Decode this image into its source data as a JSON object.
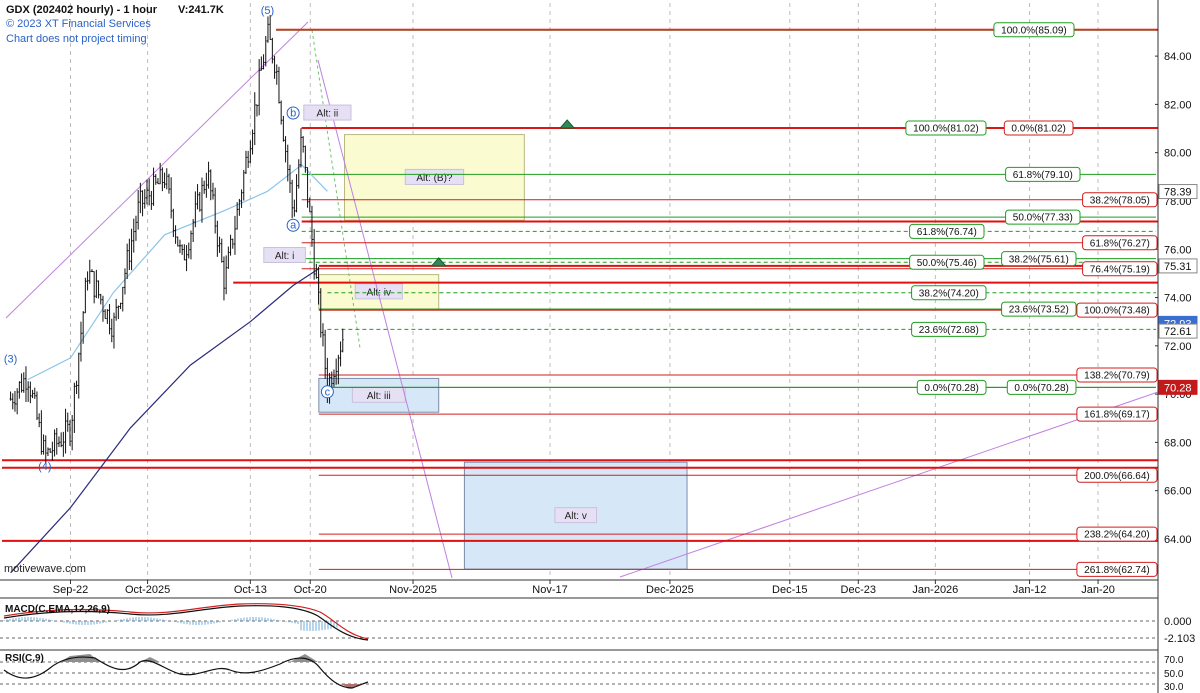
{
  "header": {
    "title": "GDX (202402 hourly) - 1 hour",
    "volume": "V:241.7K",
    "copyright": "© 2023 XT Financial Services",
    "disclaimer": "Chart does not project timing"
  },
  "watermark": "motivewave.com",
  "colors": {
    "fib_green": "#1e9e1e",
    "fib_red": "#d21e1e",
    "support_red": "#e01010",
    "olive": "#8a8a3a",
    "navy": "#2a2a7a",
    "ma_blue": "#8cc4ea",
    "purple": "#c080e0",
    "yellow_zone": "#fbfbd2",
    "blue_zone": "#d6e8f8",
    "wave_label": "#2a62c8"
  },
  "chart_data": {
    "type": "candlestick",
    "title": "GDX (202402 hourly) - 1 hour",
    "y_range": [
      62.3,
      86.2
    ],
    "y_ticks": [
      64.0,
      66.0,
      68.0,
      70.0,
      72.0,
      74.0,
      76.0,
      78.0,
      80.0,
      82.0,
      84.0
    ],
    "x_ticks": [
      {
        "label": "Sep-22",
        "date": "2025-09-22"
      },
      {
        "label": "Oct-2025",
        "date": "2025-10-01"
      },
      {
        "label": "Oct-13",
        "date": "2025-10-13"
      },
      {
        "label": "Oct-20",
        "date": "2025-10-20"
      },
      {
        "label": "Nov-2025",
        "date": "2025-11-01"
      },
      {
        "label": "Nov-17",
        "date": "2025-11-17"
      },
      {
        "label": "Dec-2025",
        "date": "2025-12-01"
      },
      {
        "label": "Dec-15",
        "date": "2025-12-15"
      },
      {
        "label": "Dec-23",
        "date": "2025-12-23"
      },
      {
        "label": "Jan-2026",
        "date": "2026-01-01"
      },
      {
        "label": "Jan-12",
        "date": "2026-01-12"
      },
      {
        "label": "Jan-20",
        "date": "2026-01-20"
      }
    ],
    "price_keypoints": [
      [
        "2025-09-15",
        69.8
      ],
      [
        "2025-09-17",
        70.8
      ],
      [
        "2025-09-19",
        67.4
      ],
      [
        "2025-09-22",
        68.6
      ],
      [
        "2025-09-24",
        75.1
      ],
      [
        "2025-09-27",
        72.8
      ],
      [
        "2025-09-30",
        77.8
      ],
      [
        "2025-10-03",
        79.0
      ],
      [
        "2025-10-05",
        75.5
      ],
      [
        "2025-10-08",
        79.2
      ],
      [
        "2025-10-10",
        74.6
      ],
      [
        "2025-10-12",
        78.6
      ],
      [
        "2025-10-15",
        84.9
      ],
      [
        "2025-10-16",
        83.6
      ],
      [
        "2025-10-18",
        77.4
      ],
      [
        "2025-10-19",
        80.6
      ],
      [
        "2025-10-21",
        73.6
      ],
      [
        "2025-10-22",
        70.3
      ],
      [
        "2025-10-24",
        72.6
      ]
    ],
    "moving_averages": [
      {
        "name": "short MA",
        "color": "#8cc4ea",
        "points": [
          [
            "2025-09-17",
            70.6
          ],
          [
            "2025-09-22",
            71.5
          ],
          [
            "2025-09-27",
            74.2
          ],
          [
            "2025-10-03",
            76.6
          ],
          [
            "2025-10-10",
            77.6
          ],
          [
            "2025-10-15",
            78.4
          ],
          [
            "2025-10-19",
            79.5
          ],
          [
            "2025-10-22",
            78.4
          ]
        ]
      },
      {
        "name": "long MA",
        "color": "#2a2a7a",
        "points": [
          [
            "2025-09-15",
            62.6
          ],
          [
            "2025-09-22",
            65.3
          ],
          [
            "2025-09-29",
            68.6
          ],
          [
            "2025-10-06",
            71.2
          ],
          [
            "2025-10-13",
            73.0
          ],
          [
            "2025-10-18",
            74.5
          ],
          [
            "2025-10-21",
            75.2
          ]
        ]
      }
    ],
    "horizontal_levels": [
      {
        "label": "100.0%(85.09)",
        "value": 85.09,
        "color": "green",
        "from": "2025-10-16"
      },
      {
        "label": "100.0%(81.02)",
        "value": 81.02,
        "color": "green",
        "from": "2025-10-19"
      },
      {
        "label": "0.0%(81.02)",
        "value": 81.02,
        "color": "red",
        "from": "2025-10-19"
      },
      {
        "label": "61.8%(79.10)",
        "value": 79.1,
        "color": "green",
        "from": "2025-10-19"
      },
      {
        "label": "38.2%(78.05)",
        "value": 78.05,
        "color": "red",
        "from": "2025-10-19"
      },
      {
        "label": "50.0%(77.33)",
        "value": 77.33,
        "color": "green",
        "from": "2025-10-19"
      },
      {
        "label": "61.8%(76.74)",
        "value": 76.74,
        "color": "green",
        "dashed": true,
        "from": "2025-10-19"
      },
      {
        "label": "61.8%(76.27)",
        "value": 76.27,
        "color": "red",
        "from": "2025-10-19"
      },
      {
        "label": "38.2%(75.61)",
        "value": 75.61,
        "color": "green",
        "from": "2025-10-19"
      },
      {
        "label": "50.0%(75.46)",
        "value": 75.46,
        "color": "green",
        "dashed": true,
        "from": "2025-10-19"
      },
      {
        "label": "76.4%(75.19)",
        "value": 75.19,
        "color": "red",
        "from": "2025-10-19"
      },
      {
        "label": "38.2%(74.20)",
        "value": 74.2,
        "color": "green",
        "dashed": true,
        "from": "2025-10-22"
      },
      {
        "label": "23.6%(73.52)",
        "value": 73.52,
        "color": "green",
        "from": "2025-10-21"
      },
      {
        "label": "100.0%(73.48)",
        "value": 73.48,
        "color": "red",
        "from": "2025-10-21"
      },
      {
        "label": "23.6%(72.68)",
        "value": 72.68,
        "color": "green",
        "dashed": true,
        "from": "2025-10-22"
      },
      {
        "label": "138.2%(70.79)",
        "value": 70.79,
        "color": "red",
        "from": "2025-10-21"
      },
      {
        "label": "0.0%(70.28)",
        "value": 70.28,
        "color": "green",
        "from": "2025-10-22"
      },
      {
        "label": "0.0%(70.28)",
        "value": 70.28,
        "color": "green",
        "from": "2025-10-22"
      },
      {
        "label": "161.8%(69.17)",
        "value": 69.17,
        "color": "red",
        "from": "2025-10-21"
      },
      {
        "label": "200.0%(66.64)",
        "value": 66.64,
        "color": "red",
        "from": "2025-10-21"
      },
      {
        "label": "238.2%(64.20)",
        "value": 64.2,
        "color": "red",
        "from": "2025-10-21"
      },
      {
        "label": "261.8%(62.74)",
        "value": 62.74,
        "color": "red",
        "from": "2025-10-21"
      }
    ],
    "support_lines": [
      {
        "value": 85.09,
        "from": "2025-10-16",
        "color": "red"
      },
      {
        "value": 81.02,
        "from": "2025-10-19",
        "color": "red"
      },
      {
        "value": 77.15,
        "from": "2025-10-19",
        "color": "red"
      },
      {
        "value": 75.31,
        "from": "2025-10-21",
        "color": "red"
      },
      {
        "value": 74.62,
        "from": "2025-10-11",
        "color": "red"
      },
      {
        "value": 73.5,
        "from": "2025-10-21",
        "color": "olive"
      },
      {
        "value": 67.26,
        "from": "2025-09-14",
        "color": "red"
      },
      {
        "value": 66.95,
        "from": "2025-09-14",
        "color": "red"
      },
      {
        "value": 63.92,
        "from": "2025-09-14",
        "color": "red"
      }
    ],
    "zones": [
      {
        "label": "Alt: (B)?",
        "x0": "2025-10-24",
        "x1": "2025-11-14",
        "y0": 77.2,
        "y1": 80.75,
        "color": "yellow"
      },
      {
        "label": "Alt: iv",
        "x0": "2025-10-21",
        "x1": "2025-11-04",
        "y0": 73.52,
        "y1": 74.95,
        "color": "yellow"
      },
      {
        "label": "Alt: iii",
        "x0": "2025-10-21",
        "x1": "2025-11-04",
        "y0": 69.25,
        "y1": 70.65,
        "color": "blue"
      },
      {
        "label": "Alt: v",
        "x0": "2025-11-07",
        "x1": "2025-12-03",
        "y0": 62.75,
        "y1": 67.18,
        "color": "blue"
      }
    ],
    "wave_labels": [
      {
        "text": "(5)",
        "date": "2025-10-15",
        "value": 85.75
      },
      {
        "text": "(3)",
        "date": "2025-09-15",
        "value": 71.3
      },
      {
        "text": "(4)",
        "date": "2025-09-19",
        "value": 66.85
      },
      {
        "text": "b",
        "date": "2025-10-18",
        "value": 81.5,
        "circled": true
      },
      {
        "text": "a",
        "date": "2025-10-18",
        "value": 76.85,
        "circled": true
      },
      {
        "text": "c",
        "date": "2025-10-22",
        "value": 69.95,
        "circled": true
      }
    ],
    "alt_labels": [
      {
        "text": "Alt: ii",
        "date": "2025-10-22",
        "value": 81.6
      },
      {
        "text": "Alt: i",
        "date": "2025-10-17",
        "value": 75.7
      }
    ],
    "triangles": [
      {
        "date": "2025-11-19",
        "value": 81.02
      },
      {
        "date": "2025-11-04",
        "value": 75.31
      }
    ],
    "right_axis_badges": [
      {
        "label": "78.39",
        "value": 78.39,
        "style": "plain"
      },
      {
        "label": "75.31",
        "value": 75.31,
        "style": "plain"
      },
      {
        "label": "72.93",
        "value": 72.93,
        "style": "blue"
      },
      {
        "label": "72.61",
        "value": 72.61,
        "style": "plain"
      },
      {
        "label": "70.28",
        "value": 70.28,
        "style": "red"
      }
    ],
    "macd": {
      "title": "MACD(C,EMA,12,26,9)",
      "y_ticks": [
        0.0,
        -2.103
      ],
      "y_tick_labels": [
        "0.000",
        "-2.103"
      ]
    },
    "rsi": {
      "title": "RSI(C,9)",
      "y_ticks": [
        70.0,
        50.0,
        30.0
      ],
      "y_tick_labels": [
        "70.0",
        "50.0",
        "30.0"
      ]
    }
  }
}
